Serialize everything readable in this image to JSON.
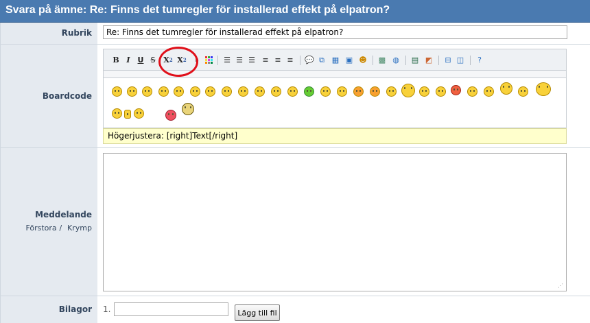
{
  "header": {
    "title": "Svara på ämne: Re: Finns det tumregler för installerad effekt på elpatron?"
  },
  "subject": {
    "label": "Rubrik",
    "value": "Re: Finns det tumregler för installerad effekt på elpatron?"
  },
  "boardcode": {
    "label": "Boardcode",
    "buttons": {
      "bold": "B",
      "italic": "I",
      "underline": "U",
      "strike": "S",
      "subscript": "X",
      "subscript_mark": "2",
      "superscript": "X",
      "superscript_mark": "2"
    },
    "hint": "Högerjustera: [right]Text[/right]",
    "colors": {
      "toolbar_bg": "#eef1f4",
      "hint_bg": "#ffffcc",
      "highlight_circle": "#e0101a"
    }
  },
  "message": {
    "label": "Meddelande",
    "enlarge": "Förstora",
    "sep": "/",
    "shrink": "Krymp"
  },
  "attachments": {
    "label": "Bilagor",
    "index": "1.",
    "add_button": "Lägg till fil"
  },
  "theme": {
    "header_bg": "#4a7ab0",
    "label_bg": "#e5eaf0",
    "label_text": "#33465e"
  }
}
